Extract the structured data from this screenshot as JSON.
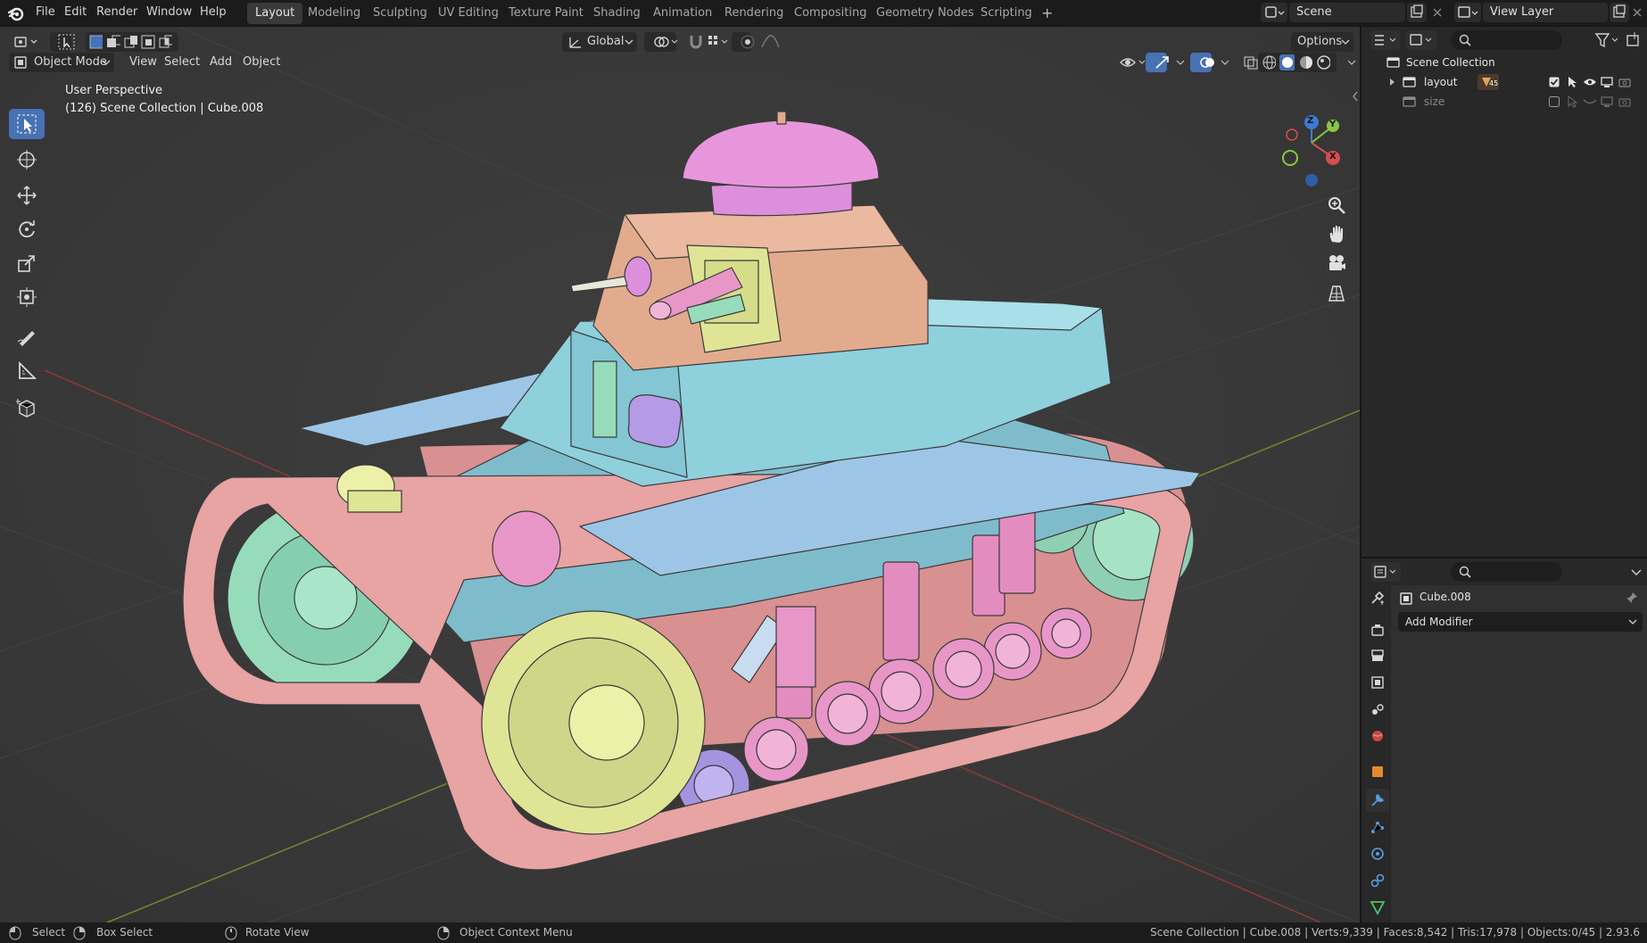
{
  "topbar": {
    "menus": [
      "File",
      "Edit",
      "Render",
      "Window",
      "Help"
    ],
    "workspaces": [
      "Layout",
      "Modeling",
      "Sculpting",
      "UV Editing",
      "Texture Paint",
      "Shading",
      "Animation",
      "Rendering",
      "Compositing",
      "Geometry Nodes",
      "Scripting"
    ],
    "active_workspace": "Layout",
    "add_workspace": "+",
    "scene_name": "Scene",
    "view_layer_name": "View Layer"
  },
  "viewport_header": {
    "transform_orientation": "Global",
    "options_label": "Options",
    "mode": "Object Mode",
    "menus": [
      "View",
      "Select",
      "Add",
      "Object"
    ]
  },
  "viewport": {
    "perspective_label": "User Perspective",
    "collection_info": "(126) Scene Collection | Cube.008",
    "gizmo_axes": [
      "Z",
      "Y",
      "X"
    ]
  },
  "outliner": {
    "root": "Scene Collection",
    "items": [
      {
        "name": "layout",
        "badge": "45"
      },
      {
        "name": "size"
      }
    ]
  },
  "properties": {
    "object_name": "Cube.008",
    "add_modifier_label": "Add Modifier"
  },
  "statusbar": {
    "select": "Select",
    "box_select": "Box Select",
    "rotate_view": "Rotate View",
    "context_menu": "Object Context Menu",
    "stats": "Scene Collection | Cube.008 | Verts:9,339 | Faces:8,542 | Tris:17,978 | Objects:0/45 | 2.93.6"
  },
  "colors": {
    "accent": "#4772b3",
    "track": "#e8a3a3",
    "hull": "#92cfdc",
    "turret": "#e2ab8e",
    "hatch": "#dc8fdc",
    "wheel_green": "#96dcbb",
    "wheel_yellow": "#e0e596",
    "wheel_pink": "#e896c8",
    "wheel_purple": "#a494e0",
    "axis_x": "#d84d4d",
    "axis_y": "#8cc53f",
    "axis_z": "#3b7bd4"
  }
}
